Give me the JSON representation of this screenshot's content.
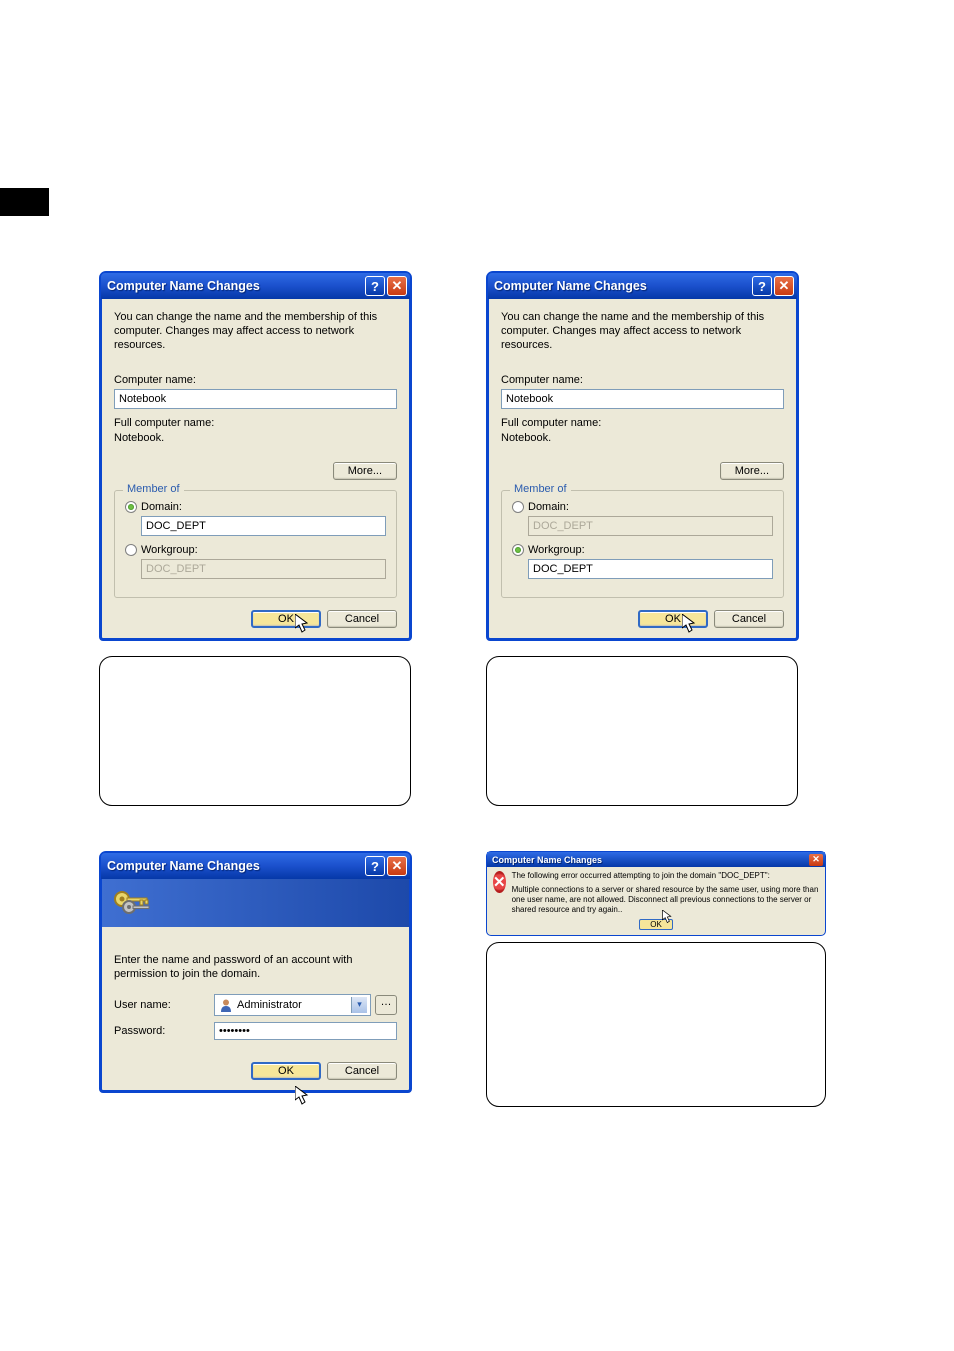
{
  "dialog1": {
    "title": "Computer Name Changes",
    "desc": "You can change the name and the membership of this computer. Changes may affect access to network resources.",
    "computer_name_label": "Computer name:",
    "computer_name": "Notebook",
    "full_name_label": "Full computer name:",
    "full_name": "Notebook.",
    "more_btn": "More...",
    "member_of": "Member of",
    "domain_label": "Domain:",
    "domain_value": "DOC_DEPT",
    "workgroup_label": "Workgroup:",
    "workgroup_value": "DOC_DEPT",
    "ok": "OK",
    "cancel": "Cancel"
  },
  "dialog2": {
    "title": "Computer Name Changes",
    "desc": "You can change the name and the membership of this computer. Changes may affect access to network resources.",
    "computer_name_label": "Computer name:",
    "computer_name": "Notebook",
    "full_name_label": "Full computer name:",
    "full_name": "Notebook.",
    "more_btn": "More...",
    "member_of": "Member of",
    "domain_label": "Domain:",
    "domain_value": "DOC_DEPT",
    "workgroup_label": "Workgroup:",
    "workgroup_value": "DOC_DEPT",
    "ok": "OK",
    "cancel": "Cancel"
  },
  "cred": {
    "title": "Computer Name Changes",
    "prompt": "Enter the name and password of an account with permission to join the domain.",
    "user_label": "User name:",
    "user_value": "Administrator",
    "pwd_label": "Password:",
    "pwd_value": "••••••••",
    "ok": "OK",
    "cancel": "Cancel"
  },
  "err": {
    "title": "Computer Name Changes",
    "line1": "The following error occurred attempting to join the domain \"DOC_DEPT\":",
    "line2": "Multiple connections to a server or shared resource by the same user, using more than one user name, are not allowed. Disconnect all previous connections to the server or shared resource and try again..",
    "ok": "OK"
  }
}
